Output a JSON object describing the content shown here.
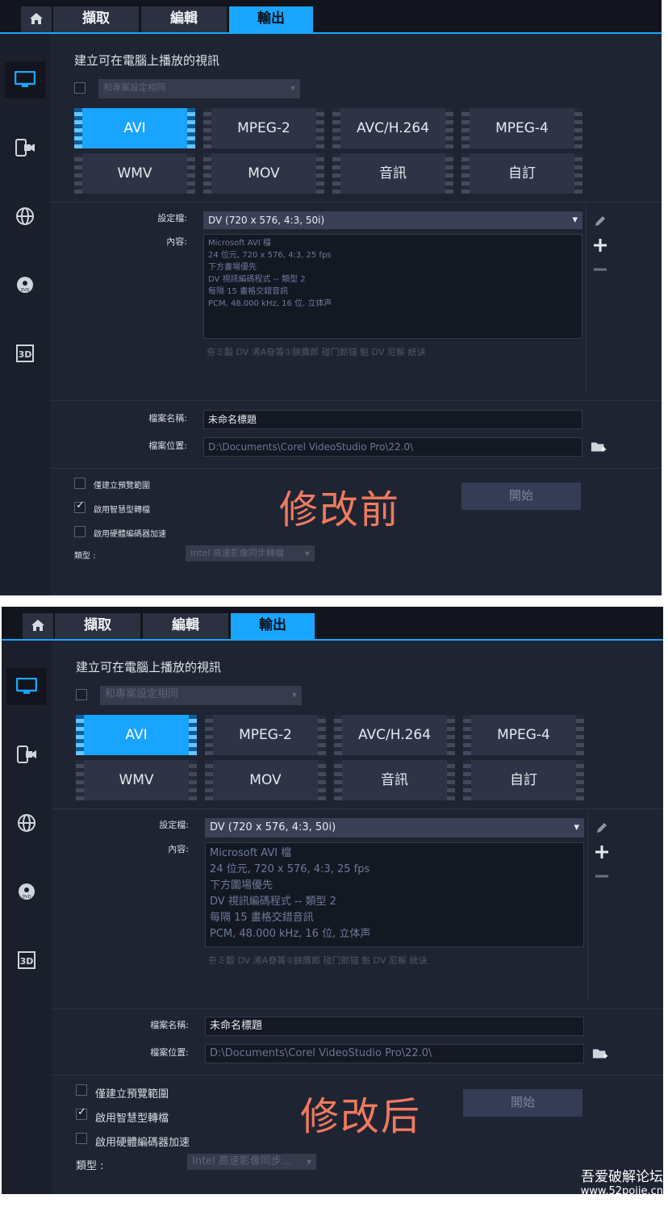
{
  "tabs": {
    "capture": "擷取",
    "edit": "編輯",
    "output": "輸出"
  },
  "sidebar": [
    "computer-icon",
    "mobile-device-icon",
    "web-globe-icon",
    "disc-dvd-icon",
    "3d-icon"
  ],
  "main": {
    "heading": "建立可在電腦上播放的視訊",
    "match_project_dropdown": "和專案設定相同",
    "formats": [
      "AVI",
      "MPEG-2",
      "AVC/H.264",
      "MPEG-4",
      "WMV",
      "MOV",
      "音訊",
      "自訂"
    ],
    "active_format": "AVI",
    "profile_label": "設定檔:",
    "profile_value": "DV (720 x 576, 4:3, 50i)",
    "content_label": "內容:",
    "content_lines": [
      "Microsoft AVI 檔",
      "24 位元, 720 x 576, 4:3, 25 fps",
      "下方圖場優先",
      "DV 視訊編碼程式 -- 類型 2",
      "每隔 15 畫格交錯音訊",
      "PCM, 48.000 kHz, 16 位, 立体声"
    ],
    "content_lines_before": [
      "Microsoft AVI 檔",
      "24 位元, 720 x 576, 4:3, 25 fps",
      "下方畫場優先",
      "DV 視訊編碼程式 -- 類型 2",
      "每隔 15 畫格交錯音訊",
      "PCM, 48.000 kHz, 16 位, 立体声"
    ],
    "garbled_line": "夯ミ觳 DV 浠A眘箐①鋏膺郎     碰冂郎锚   魁   DV 尼鬃   絖诀",
    "filename_label": "檔案名稱:",
    "filename_value": "未命名標題",
    "location_label": "檔案位置:",
    "location_value": "D:\\Documents\\Corel VideoStudio Pro\\22.0\\",
    "options": {
      "preview_range": "僅建立預覽範圍",
      "smart_render": "啟用智慧型轉檔",
      "smart_render_checked": true,
      "hw_encoder": "啟用硬體編碼器加速",
      "type_label": "類型 :",
      "type_value_before": "Intel 高速影像同步轉檔",
      "type_value_after": "Intel 高速影像同步..."
    },
    "start_button": "開始"
  },
  "annotations": {
    "before": "修改前",
    "after": "修改后"
  },
  "forum": {
    "name": "吾爱破解论坛",
    "url": "www.52pojie.cn"
  },
  "colors": {
    "accent": "#1aa6ff",
    "panel": "#1f2433",
    "annotation": "#f07a5e"
  }
}
